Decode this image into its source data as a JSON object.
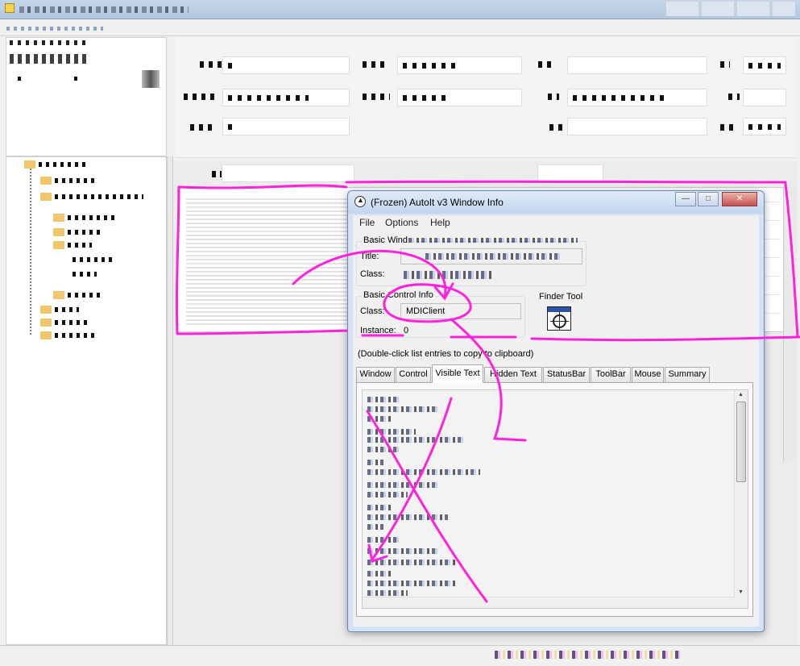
{
  "dialog": {
    "title": "(Frozen) AutoIt v3 Window Info",
    "menu": [
      "File",
      "Options",
      "Help"
    ],
    "window_buttons": [
      "minimize",
      "maximize",
      "close"
    ],
    "basic_window_info": {
      "group_title": "Basic Wind",
      "title_label": "Title:",
      "class_label": "Class:"
    },
    "basic_control_info": {
      "group_title": "Basic Control Info",
      "class_label": "Class:",
      "class_value": "MDIClient",
      "instance_label": "Instance:",
      "instance_value": "0"
    },
    "finder_tool": {
      "label": "Finder Tool",
      "icon": "crosshair-icon"
    },
    "hint": "(Double-click list entries to copy to clipboard)",
    "tabs": [
      "Window",
      "Control",
      "Visible Text",
      "Hidden Text",
      "StatusBar",
      "ToolBar",
      "Mouse",
      "Summary"
    ],
    "active_tab": "Visible Text"
  },
  "colors": {
    "annotation": "#ff22dd",
    "dialog_frame": "#d4e3f4",
    "folder": "#f2c66a"
  },
  "annotations": [
    "highlight-rectangle",
    "curved-arrow",
    "cross-out"
  ]
}
